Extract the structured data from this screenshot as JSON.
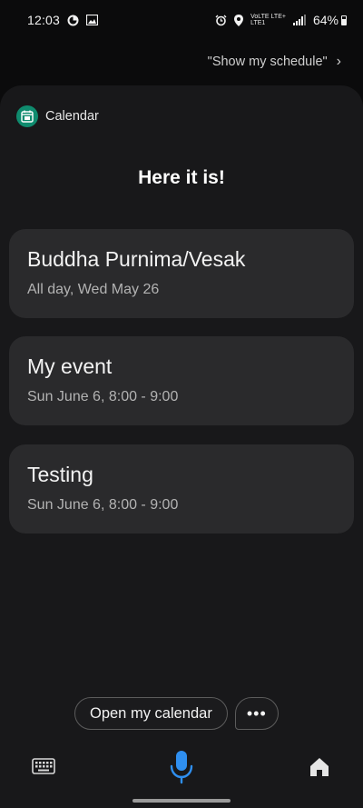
{
  "status_bar": {
    "time": "12:03",
    "network_line1": "VoLTE LTE+",
    "network_line2": "LTE1",
    "battery": "64%"
  },
  "assistant": {
    "suggestion": "\"Show my schedule\""
  },
  "calendar": {
    "app_name": "Calendar",
    "title": "Here it is!",
    "events": [
      {
        "title": "Buddha Purnima/Vesak",
        "date": "All day, Wed May 26"
      },
      {
        "title": "My event",
        "date": "Sun June 6, 8:00 - 9:00"
      },
      {
        "title": "Testing",
        "date": "Sun June 6, 8:00 - 9:00"
      }
    ]
  },
  "actions": {
    "open_calendar": "Open my calendar",
    "more": "•••"
  },
  "colors": {
    "accent_mic": "#2f8ff0",
    "calendar_icon": "#0f8b6e",
    "card_bg": "#2a2a2c"
  },
  "icons": {
    "keyboard": "keyboard-icon",
    "mic": "mic-icon",
    "home": "home-icon"
  }
}
